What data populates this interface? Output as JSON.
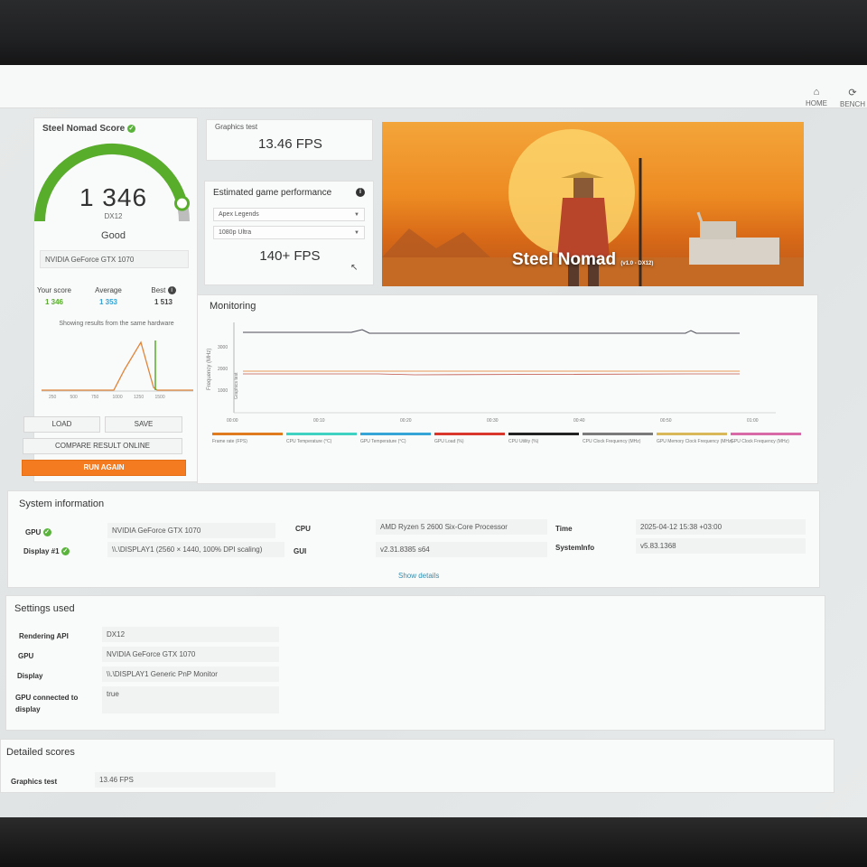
{
  "nav": {
    "home": "HOME",
    "benchmarks": "BENCH"
  },
  "score": {
    "title": "Steel Nomad Score",
    "value": "1 346",
    "api": "DX12",
    "rating": "Good",
    "gauge_fraction": 0.92,
    "hardware": "NVIDIA GeForce GTX 1070",
    "your_score_label": "Your score",
    "your_score": "1 346",
    "average_label": "Average",
    "average": "1 353",
    "best_label": "Best",
    "best": "1 513",
    "same_hw_text": "Showing results from the same hardware",
    "dist_ticks": [
      "250",
      "500",
      "750",
      "1000",
      "1250",
      "1500"
    ],
    "load_label": "LOAD",
    "save_label": "SAVE",
    "compare_label": "COMPARE RESULT ONLINE",
    "run_label": "RUN AGAIN"
  },
  "graphics_test": {
    "label": "Graphics test",
    "value": "13.46 FPS"
  },
  "estimated": {
    "title": "Estimated game performance",
    "game": "Apex Legends",
    "preset": "1080p Ultra",
    "fps": "140+ FPS"
  },
  "hero": {
    "title": "Steel Nomad",
    "version": "(v1.0 - DX12)"
  },
  "monitoring": {
    "title": "Monitoring",
    "y_axis_label": "Frequency (MHz)",
    "y_axis_sub": "Graphics test",
    "y_ticks": [
      "3000",
      "2000",
      "1000"
    ],
    "x_ticks": [
      "00:00",
      "00:10",
      "00:20",
      "00:30",
      "00:40",
      "00:50",
      "01:00"
    ],
    "legend": [
      {
        "label": "Frame rate (FPS)",
        "color": "#e07b1f"
      },
      {
        "label": "CPU Temperature (°C)",
        "color": "#3fd1c1"
      },
      {
        "label": "GPU Temperature (°C)",
        "color": "#35a4d6"
      },
      {
        "label": "GPU Load (%)",
        "color": "#d9372c"
      },
      {
        "label": "CPU Utility (%)",
        "color": "#222222"
      },
      {
        "label": "CPU Clock Frequency (MHz)",
        "color": "#7a7a7a"
      },
      {
        "label": "GPU Memory Clock Frequency (MHz)",
        "color": "#d9b85a"
      },
      {
        "label": "GPU Clock Frequency (MHz)",
        "color": "#d86aa8"
      }
    ]
  },
  "system": {
    "title": "System information",
    "gpu_label": "GPU",
    "gpu": "NVIDIA GeForce GTX 1070",
    "display_label": "Display #1",
    "display": "\\\\.\\DISPLAY1 (2560 × 1440, 100% DPI scaling)",
    "cpu_label": "CPU",
    "cpu": "AMD Ryzen 5 2600 Six-Core Processor",
    "gui_label": "GUI",
    "gui": "v2.31.8385 s64",
    "time_label": "Time",
    "time": "2025-04-12 15:38 +03:00",
    "sysinfo_label": "SystemInfo",
    "sysinfo": "v5.83.1368",
    "show_details": "Show details"
  },
  "settings": {
    "title": "Settings used",
    "rows": [
      {
        "label": "Rendering API",
        "value": "DX12"
      },
      {
        "label": "GPU",
        "value": "NVIDIA GeForce GTX 1070"
      },
      {
        "label": "Display",
        "value": "\\\\.\\DISPLAY1 Generic PnP Monitor"
      },
      {
        "label": "GPU connected to display",
        "value": "true"
      }
    ]
  },
  "detailed": {
    "title": "Detailed scores",
    "graphics_label": "Graphics test",
    "graphics_value": "13.46 FPS"
  }
}
